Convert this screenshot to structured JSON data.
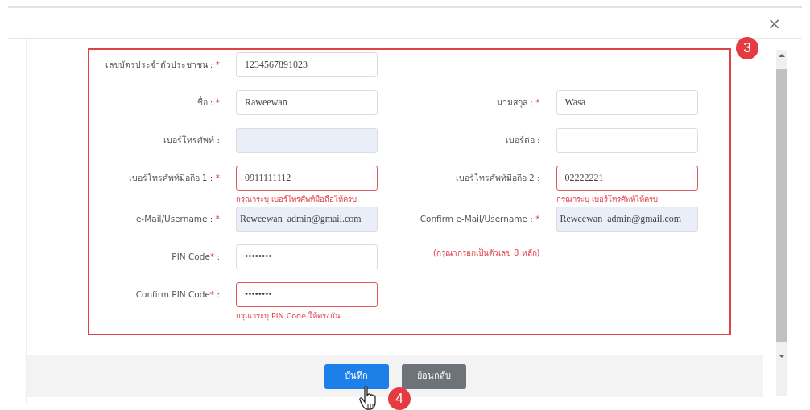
{
  "dialog": {
    "close": "×"
  },
  "annotations": [
    {
      "text": "3"
    },
    {
      "text": "4"
    }
  ],
  "rows": [
    {
      "left": {
        "label": "เลขบัตรประจำตัวประชาชน :",
        "required_mark": "*",
        "value": "1234567891023",
        "readonly": false,
        "invalid": false
      }
    },
    {
      "left": {
        "label": "ชื่อ :",
        "required_mark": "*",
        "value": "Raweewan",
        "readonly": false,
        "invalid": false
      },
      "right": {
        "kind": "field",
        "label": "นามสกุล :",
        "required_mark": "*",
        "value": "Wasa",
        "readonly": false,
        "invalid": false
      }
    },
    {
      "left": {
        "label": "เบอร์โทรศัพท์ :",
        "readonly": true,
        "invalid": false
      },
      "right": {
        "kind": "field",
        "label": "เบอร์ต่อ :",
        "readonly": false,
        "invalid": false
      }
    },
    {
      "left": {
        "label": "เบอร์โทรศัพท์มือถือ 1 :",
        "required_mark": "*",
        "value": "0911111112",
        "readonly": false,
        "invalid": true,
        "error": "กรุณาระบุ เบอร์โทรศัพท์มือถือให้ครบ"
      },
      "right": {
        "kind": "field",
        "label": "เบอร์โทรศัพท์มือถือ 2 :",
        "value": "02222221",
        "readonly": false,
        "invalid": true,
        "error": "กรุณาระบุ เบอร์โทรศัพท์ให้ครบ"
      }
    },
    {
      "left": {
        "label": "e-Mail/Username :",
        "required_mark": "*",
        "value": "Reweewan_admin@gmail.com",
        "readonly": true,
        "invalid": false
      },
      "right": {
        "kind": "field",
        "label": "Confirm e-Mail/Username :",
        "required_mark": "*",
        "value": "Reweewan_admin@gmail.com",
        "readonly": true,
        "invalid": false
      }
    },
    {
      "left": {
        "label": "PIN Code",
        "required_mark": "*",
        "after_mark": " :",
        "value": "••••••••",
        "readonly": false,
        "invalid": false
      },
      "right": {
        "kind": "note",
        "text": "(กรุณากรอกเป็นตัวเลข 8 หลัก)"
      }
    },
    {
      "left": {
        "label": "Confirm PIN Code",
        "required_mark": "*",
        "after_mark": " :",
        "value": "••••••••",
        "readonly": false,
        "invalid": true,
        "error": "กรุณาระบุ PIN Code ให้ตรงกัน"
      }
    }
  ],
  "buttons": [
    {
      "label": "บันทึก",
      "kind": "primary"
    },
    {
      "label": "ย้อนกลับ",
      "kind": "secondary"
    }
  ]
}
